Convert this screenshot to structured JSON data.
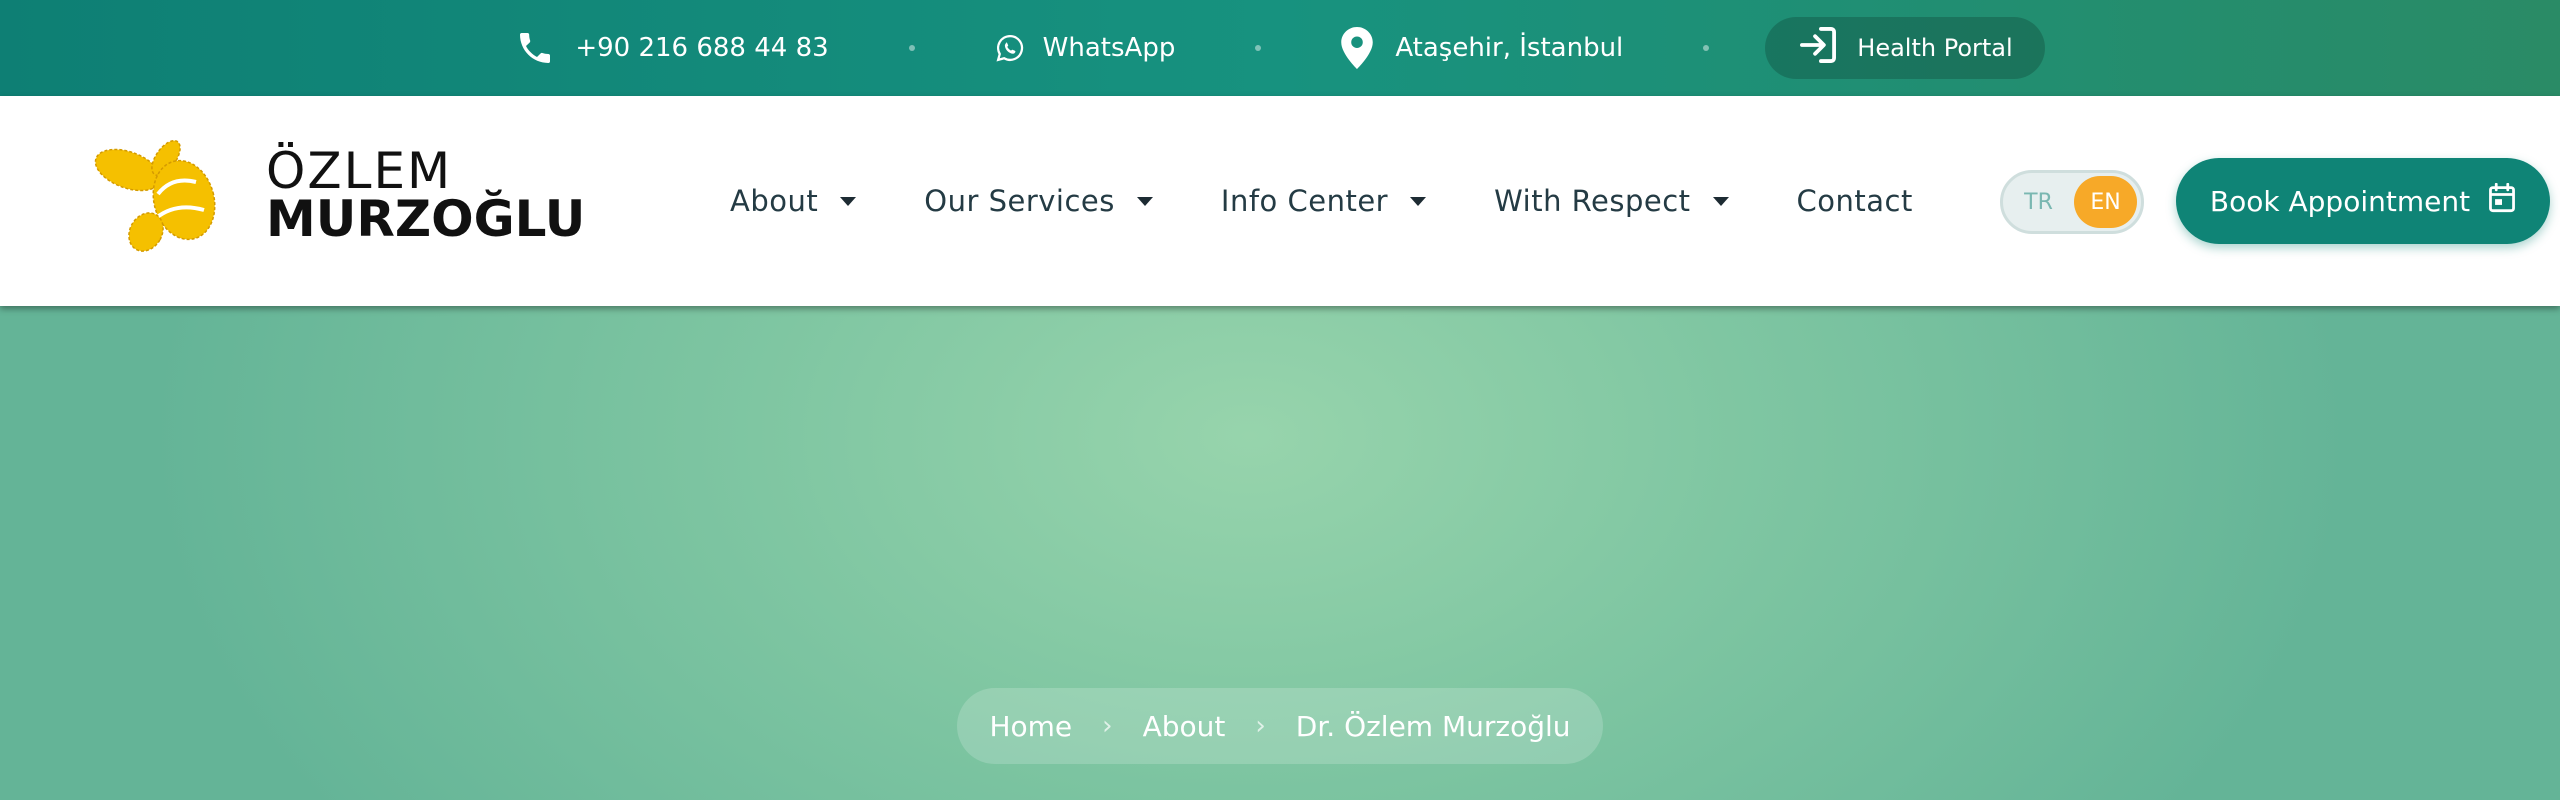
{
  "topbar": {
    "phone": "+90 216 688 44 83",
    "whatsapp": "WhatsApp",
    "location": "Ataşehir, İstanbul",
    "portal": "Health Portal"
  },
  "logo": {
    "line1": "ÖZLEM",
    "line2": "MURZOĞLU"
  },
  "nav": {
    "items": [
      {
        "label": "About"
      },
      {
        "label": "Our Services"
      },
      {
        "label": "Info Center"
      },
      {
        "label": "With Respect"
      },
      {
        "label": "Contact"
      }
    ]
  },
  "lang": {
    "tr": "TR",
    "en": "EN",
    "active": "EN"
  },
  "cta": {
    "book": "Book Appointment"
  },
  "breadcrumb": {
    "items": [
      "Home",
      "About",
      "Dr. Özlem Murzoğlu"
    ]
  },
  "colors": {
    "topbar": "#0e7f74",
    "accent": "#0f8476",
    "lang_active": "#f7a928",
    "hero": "#7fc6a2",
    "logo_yellow": "#f5c000"
  },
  "icons": [
    "phone-icon",
    "whatsapp-icon",
    "location-pin-icon",
    "login-icon",
    "calendar-icon",
    "chevron-right-icon",
    "caret-down-icon"
  ]
}
